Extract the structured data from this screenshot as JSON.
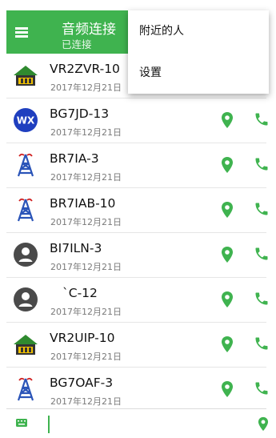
{
  "header": {
    "title": "音频连接",
    "subtitle": "已连接",
    "menu_icon": "hamburger-menu-icon",
    "background": "#3fb34f"
  },
  "dropdown": {
    "items": [
      "附近的人",
      "设置"
    ]
  },
  "stations": [
    {
      "callsign": "VR2ZVR-10",
      "date": "2017年12月21日",
      "icon": "house-icon"
    },
    {
      "callsign": "BG7JD-13",
      "date": "2017年12月21日",
      "icon": "wx-icon"
    },
    {
      "callsign": "BR7IA-3",
      "date": "2017年12月21日",
      "icon": "radio-tower-icon"
    },
    {
      "callsign": "BR7IAB-10",
      "date": "2017年12月21日",
      "icon": "radio-tower-icon"
    },
    {
      "callsign": "BI7ILN-3",
      "date": "2017年12月21日",
      "icon": "person-icon"
    },
    {
      "callsign": "`C-12",
      "date": "2017年12月21日",
      "icon": "person-icon"
    },
    {
      "callsign": "VR2UIP-10",
      "date": "2017年12月21日",
      "icon": "house-icon"
    },
    {
      "callsign": "BG7OAF-3",
      "date": "2017年12月21日",
      "icon": "radio-tower-icon"
    }
  ],
  "bottom_bar": {
    "input_value": "",
    "input_placeholder": "",
    "keyboard_icon": "keyboard-icon",
    "location_icon": "location-pin-icon"
  },
  "colors": {
    "accent": "#3fb34f",
    "wx_blue": "#1f3fbf",
    "tower_blue": "#2a54b8",
    "tower_red": "#d02020",
    "person_gray": "#4a4a4a"
  }
}
